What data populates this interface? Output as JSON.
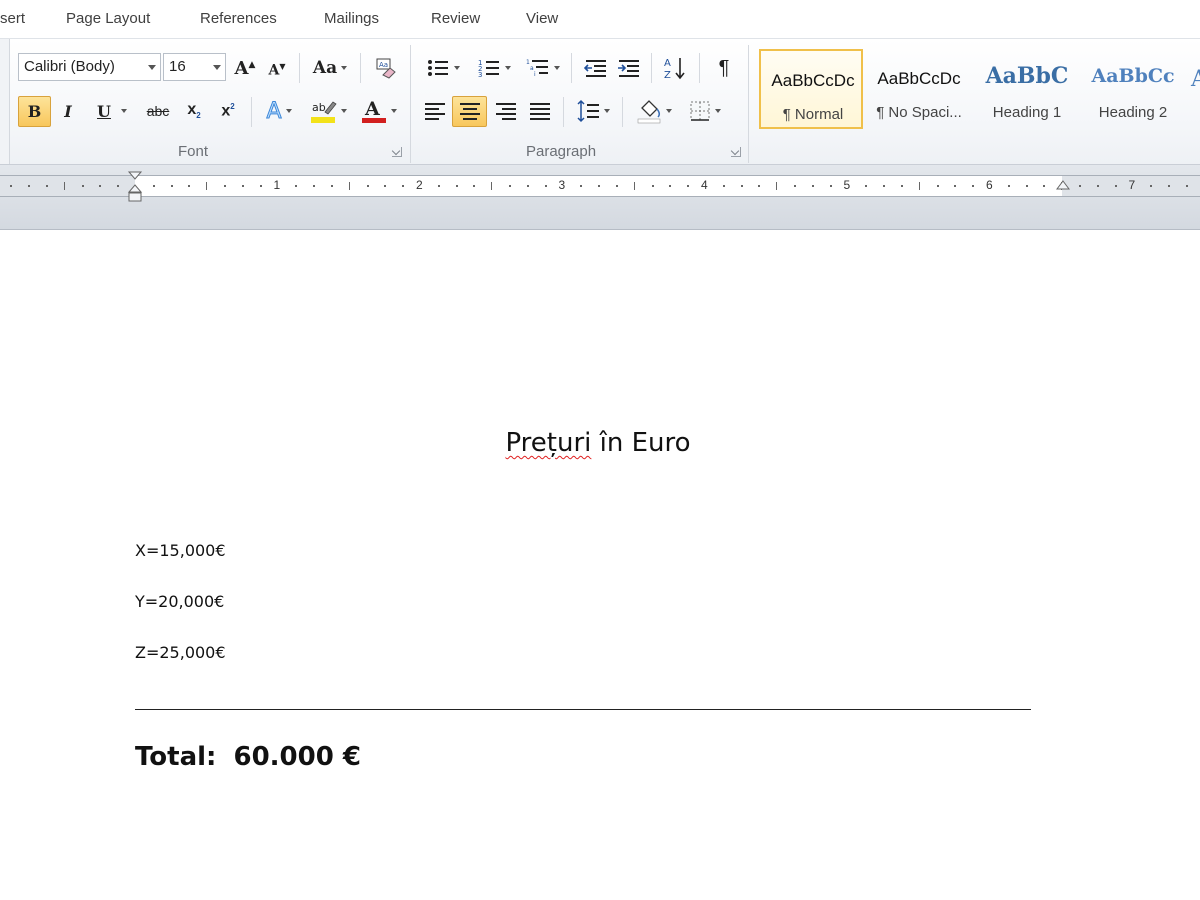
{
  "tabs": [
    "sert",
    "Page Layout",
    "References",
    "Mailings",
    "Review",
    "View"
  ],
  "font_group": {
    "font_name": "Calibri (Body)",
    "font_size": "16",
    "label": "Font"
  },
  "paragraph_group": {
    "label": "Paragraph"
  },
  "styles": [
    {
      "sample": "AaBbCcDc",
      "name": "¶ Normal",
      "selected": true
    },
    {
      "sample": "AaBbCcDc",
      "name": "¶ No Spaci...",
      "selected": false
    },
    {
      "sample": "AaBbC",
      "name": "Heading 1",
      "selected": false
    },
    {
      "sample": "AaBbCc",
      "name": "Heading 2",
      "selected": false
    }
  ],
  "ruler": {
    "numbers": [
      "1",
      "2",
      "3",
      "4",
      "5",
      "6",
      "7"
    ]
  },
  "document": {
    "title": "Prețuri în Euro",
    "lines": [
      " X=15,000€",
      "Y=20,000€",
      "Z=25,000€"
    ],
    "total_label": "Total:",
    "total_value": "60.000 €"
  },
  "colors": {
    "highlight": "#f3e21a",
    "font_color": "#d21f1f",
    "heading_blue": "#3a6ea5",
    "active_button": "#f8c75c"
  }
}
